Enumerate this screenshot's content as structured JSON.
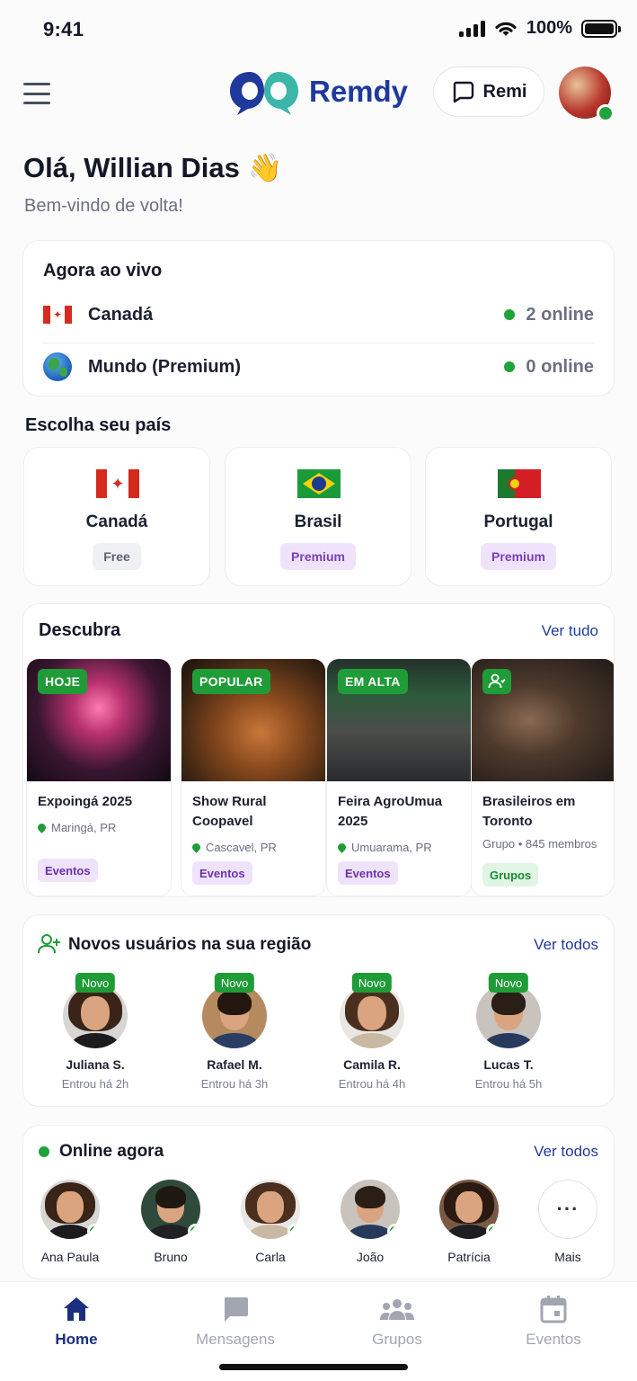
{
  "status_bar": {
    "time": "9:41",
    "battery": "100%"
  },
  "header": {
    "app_name": "Remdy",
    "assistant_label": "Remi"
  },
  "greeting": {
    "title": "Olá, Willian Dias 👋",
    "subtitle": "Bem-vindo de volta!"
  },
  "live": {
    "title": "Agora ao vivo",
    "rows": [
      {
        "name": "Canadá",
        "status": "2 online"
      },
      {
        "name": "Mundo (Premium)",
        "status": "0 online"
      }
    ]
  },
  "countries": {
    "title": "Escolha seu país",
    "items": [
      {
        "name": "Canadá",
        "tier": "Free"
      },
      {
        "name": "Brasil",
        "tier": "Premium"
      },
      {
        "name": "Portugal",
        "tier": "Premium"
      }
    ]
  },
  "discover": {
    "title": "Descubra",
    "see_all": "Ver tudo",
    "items": [
      {
        "tag": "HOJE",
        "title": "Expoingá 2025",
        "meta": "Maringá, PR",
        "category": "Eventos"
      },
      {
        "tag": "POPULAR",
        "title": "Show Rural Coopavel",
        "meta": "Cascavel, PR",
        "category": "Eventos"
      },
      {
        "tag": "EM ALTA",
        "title": "Feira AgroUmua 2025",
        "meta": "Umuarama, PR",
        "category": "Eventos"
      },
      {
        "tag": "",
        "title": "Brasileiros em Toronto",
        "meta": "Grupo • 845 membros",
        "category": "Grupos"
      }
    ]
  },
  "new_users": {
    "title": "Novos usuários na sua região",
    "see_all": "Ver todos",
    "badge": "Novo",
    "items": [
      {
        "name": "Juliana S.",
        "joined": "Entrou há 2h"
      },
      {
        "name": "Rafael M.",
        "joined": "Entrou há 3h"
      },
      {
        "name": "Camila R.",
        "joined": "Entrou há 4h"
      },
      {
        "name": "Lucas T.",
        "joined": "Entrou há 5h"
      }
    ]
  },
  "online_now": {
    "title": "Online agora",
    "see_all": "Ver todos",
    "items": [
      {
        "name": "Ana Paula"
      },
      {
        "name": "Bruno"
      },
      {
        "name": "Carla"
      },
      {
        "name": "João"
      },
      {
        "name": "Patrícia"
      }
    ],
    "more_label": "Mais",
    "more_icon": "···"
  },
  "tabbar": {
    "items": [
      {
        "label": "Home"
      },
      {
        "label": "Mensagens"
      },
      {
        "label": "Grupos"
      },
      {
        "label": "Eventos"
      }
    ]
  },
  "colors": {
    "brand": "#1f3a9c",
    "online": "#1fa33a",
    "premium": "#7b3fb2"
  }
}
